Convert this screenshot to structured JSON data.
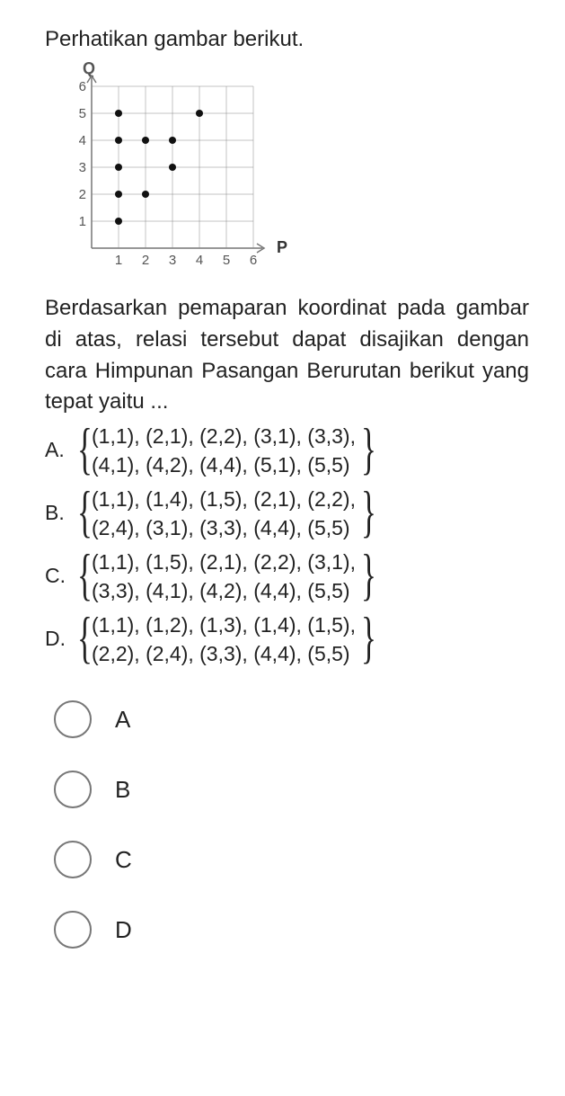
{
  "intro": "Perhatikan gambar berikut.",
  "question": "Berdasarkan pemaparan koordinat pada gambar di atas, relasi tersebut dapat disajikan dengan cara Himpunan Pasangan Berurutan berikut yang tepat yaitu ...",
  "axes": {
    "x_label": "P",
    "y_label": "Q",
    "x_ticks": [
      "1",
      "2",
      "3",
      "4",
      "5",
      "6"
    ],
    "y_ticks": [
      "1",
      "2",
      "3",
      "4",
      "5",
      "6"
    ]
  },
  "chart_data": {
    "type": "scatter",
    "x": [
      1,
      1,
      1,
      1,
      1,
      2,
      2,
      3,
      3,
      4
    ],
    "y": [
      1,
      2,
      3,
      4,
      5,
      2,
      4,
      3,
      4,
      5
    ],
    "xlabel": "P",
    "ylabel": "Q",
    "xlim": [
      0,
      6
    ],
    "ylim": [
      0,
      6
    ]
  },
  "options": {
    "A": {
      "letter": "A.",
      "line1": "(1,1), (2,1), (2,2), (3,1), (3,3),",
      "line2": "(4,1), (4,2), (4,4), (5,1), (5,5)"
    },
    "B": {
      "letter": "B.",
      "line1": "(1,1), (1,4), (1,5), (2,1), (2,2),",
      "line2": "(2,4), (3,1), (3,3), (4,4), (5,5)"
    },
    "C": {
      "letter": "C.",
      "line1": "(1,1), (1,5), (2,1), (2,2), (3,1),",
      "line2": "(3,3), (4,1), (4,2), (4,4), (5,5)"
    },
    "D": {
      "letter": "D.",
      "line1": "(1,1), (1,2), (1,3), (1,4), (1,5),",
      "line2": "(2,2), (2,4), (3,3), (4,4), (5,5)"
    }
  },
  "answers": {
    "A": "A",
    "B": "B",
    "C": "C",
    "D": "D"
  }
}
